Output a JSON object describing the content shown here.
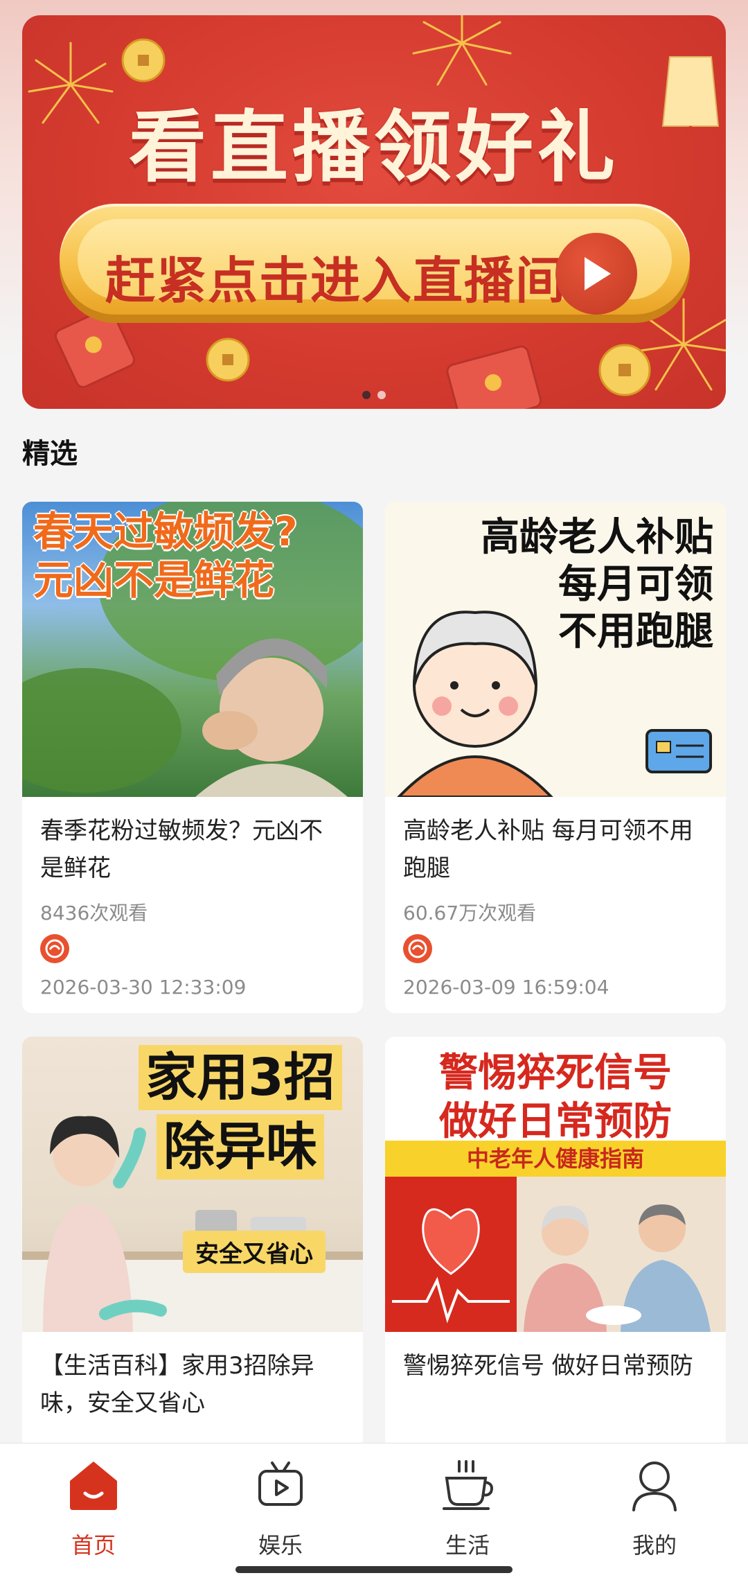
{
  "banner": {
    "title": "看直播领好礼",
    "cta_text": "赶紧点击进入直播间",
    "slide_count": 2,
    "active_slide": 1
  },
  "section": {
    "title": "精选"
  },
  "cards": [
    {
      "thumb_line1": "春天过敏频发?",
      "thumb_line2": "元凶不是鲜花",
      "title": "春季花粉过敏频发？元凶不是鲜花",
      "views": "8436次观看",
      "date": "2026-03-30 12:33:09"
    },
    {
      "thumb_line1": "高龄老人补贴",
      "thumb_line2": "每月可领",
      "thumb_line3": "不用跑腿",
      "title": "高龄老人补贴 每月可领不用跑腿",
      "views": "60.67万次观看",
      "date": "2026-03-09 16:59:04"
    },
    {
      "thumb_line1": "家用3招",
      "thumb_line2": "除异味",
      "thumb_tag": "安全又省心",
      "title": "【生活百科】家用3招除异味，安全又省心"
    },
    {
      "thumb_line1": "警惕猝死信号",
      "thumb_line2": "做好日常预防",
      "thumb_band": "中老年人健康指南",
      "title": "警惕猝死信号 做好日常预防"
    }
  ],
  "nav": {
    "items": [
      {
        "label": "首页",
        "icon": "home-icon",
        "active": true
      },
      {
        "label": "娱乐",
        "icon": "tv-icon",
        "active": false
      },
      {
        "label": "生活",
        "icon": "cup-icon",
        "active": false
      },
      {
        "label": "我的",
        "icon": "user-icon",
        "active": false
      }
    ]
  },
  "colors": {
    "accent": "#d6331e",
    "banner_red": "#d53b2f",
    "gold": "#f7c14a"
  }
}
